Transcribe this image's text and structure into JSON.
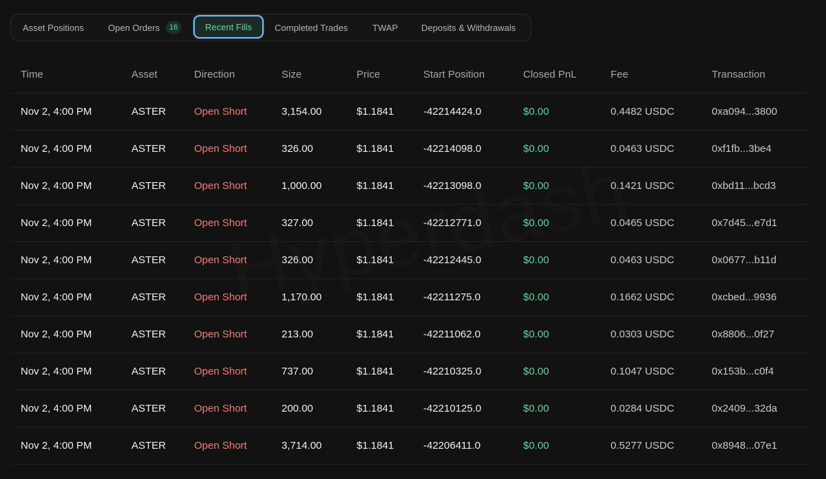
{
  "tabs": [
    {
      "label": "Asset Positions"
    },
    {
      "label": "Open Orders",
      "badge": "16"
    },
    {
      "label": "Recent Fills",
      "active": true
    },
    {
      "label": "Completed Trades"
    },
    {
      "label": "TWAP"
    },
    {
      "label": "Deposits & Withdrawals"
    }
  ],
  "watermark": "Hyperdash",
  "table": {
    "headers": [
      "Time",
      "Asset",
      "Direction",
      "Size",
      "Price",
      "Start Position",
      "Closed PnL",
      "Fee",
      "Transaction"
    ],
    "rows": [
      [
        "Nov 2, 4:00 PM",
        "ASTER",
        "Open Short",
        "3,154.00",
        "$1.1841",
        "-42214424.0",
        "$0.00",
        "0.4482 USDC",
        "0xa094...3800"
      ],
      [
        "Nov 2, 4:00 PM",
        "ASTER",
        "Open Short",
        "326.00",
        "$1.1841",
        "-42214098.0",
        "$0.00",
        "0.0463 USDC",
        "0xf1fb...3be4"
      ],
      [
        "Nov 2, 4:00 PM",
        "ASTER",
        "Open Short",
        "1,000.00",
        "$1.1841",
        "-42213098.0",
        "$0.00",
        "0.1421 USDC",
        "0xbd11...bcd3"
      ],
      [
        "Nov 2, 4:00 PM",
        "ASTER",
        "Open Short",
        "327.00",
        "$1.1841",
        "-42212771.0",
        "$0.00",
        "0.0465 USDC",
        "0x7d45...e7d1"
      ],
      [
        "Nov 2, 4:00 PM",
        "ASTER",
        "Open Short",
        "326.00",
        "$1.1841",
        "-42212445.0",
        "$0.00",
        "0.0463 USDC",
        "0x0677...b11d"
      ],
      [
        "Nov 2, 4:00 PM",
        "ASTER",
        "Open Short",
        "1,170.00",
        "$1.1841",
        "-42211275.0",
        "$0.00",
        "0.1662 USDC",
        "0xcbed...9936"
      ],
      [
        "Nov 2, 4:00 PM",
        "ASTER",
        "Open Short",
        "213.00",
        "$1.1841",
        "-42211062.0",
        "$0.00",
        "0.0303 USDC",
        "0x8806...0f27"
      ],
      [
        "Nov 2, 4:00 PM",
        "ASTER",
        "Open Short",
        "737.00",
        "$1.1841",
        "-42210325.0",
        "$0.00",
        "0.1047 USDC",
        "0x153b...c0f4"
      ],
      [
        "Nov 2, 4:00 PM",
        "ASTER",
        "Open Short",
        "200.00",
        "$1.1841",
        "-42210125.0",
        "$0.00",
        "0.0284 USDC",
        "0x2409...32da"
      ],
      [
        "Nov 2, 4:00 PM",
        "ASTER",
        "Open Short",
        "3,714.00",
        "$1.1841",
        "-42206411.0",
        "$0.00",
        "0.5277 USDC",
        "0x8948...07e1"
      ]
    ]
  },
  "colors": {
    "background": "#121212",
    "active_tab_border": "#7fb8ec",
    "active_tab_text": "#63d6a2",
    "direction_short": "#ef7f73",
    "pnl_positive": "#63d39c"
  }
}
